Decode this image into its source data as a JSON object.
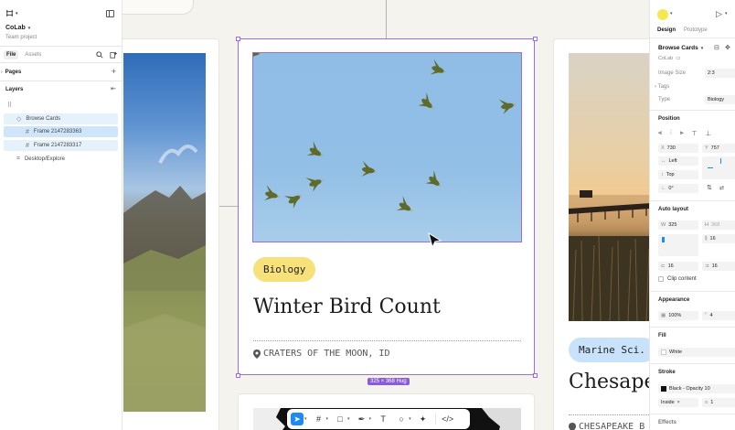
{
  "left": {
    "file_menu_icon": "frame-icon",
    "project_name": "CoLab",
    "team": "Team project",
    "tabs": [
      "File",
      "Assets"
    ],
    "pages_heading": "Pages",
    "layers_heading": "Layers",
    "layers": [
      {
        "label": "Browse Cards",
        "icon": "component-icon"
      },
      {
        "label": "Frame 2147283363",
        "icon": "frame-icon"
      },
      {
        "label": "Frame 2147283317",
        "icon": "frame-icon"
      },
      {
        "label": "Desktop/Explore",
        "icon": "component-icon"
      }
    ]
  },
  "canvas": {
    "card_main": {
      "tag": "Biology",
      "title": "Winter Bird Count",
      "location": "CRATERS OF THE MOON, ID"
    },
    "card_right": {
      "tag": "Marine Sci.",
      "title": "Chesapea",
      "location": "CHESAPEAKE B"
    },
    "selection_size": "325 × 368 Hug",
    "tag_color": "#f7e17a",
    "tag_color_marine": "#c9e2fb",
    "selection_color": "#9a6ee0"
  },
  "toolbar": {
    "tools": [
      "move-icon",
      "frame-tool-icon",
      "rectangle-icon",
      "pen-icon",
      "text-icon",
      "comment-icon",
      "actions-icon",
      "dev-mode-icon"
    ]
  },
  "right": {
    "tabs": [
      "Design",
      "Prototype"
    ],
    "component_name": "Browse Cards",
    "library": "CoLab",
    "props": [
      {
        "label": "Image Size",
        "value": "2:3"
      },
      {
        "label": "Type",
        "value": "Biology"
      }
    ],
    "tags_label": "Tags",
    "position_heading": "Position",
    "x": "730",
    "y": "757",
    "constraint_h": "Left",
    "constraint_v": "Top",
    "rotation": "0°",
    "auto_layout_heading": "Auto layout",
    "w": "325",
    "h": "368",
    "w_label": "W",
    "h_label": "H",
    "padding_v": "16",
    "padding_b": "16",
    "gap": "16",
    "clip_content": "Clip content",
    "appearance_heading": "Appearance",
    "opacity": "100%",
    "radius": "4",
    "fill_heading": "Fill",
    "fill_value": "White",
    "stroke_heading": "Stroke",
    "stroke_value": "Black - Opacity 10",
    "stroke_position": "Inside",
    "stroke_weight": "1",
    "effects_heading": "Effects"
  }
}
